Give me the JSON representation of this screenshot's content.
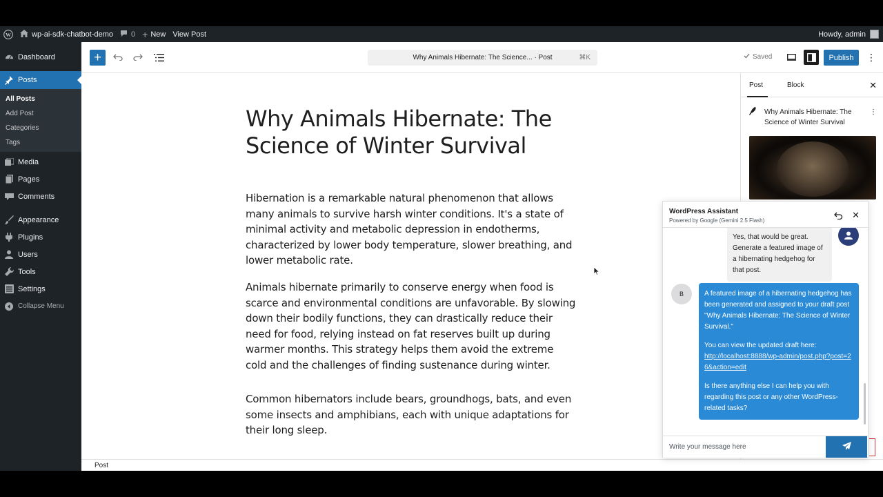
{
  "admin_bar": {
    "site_name": "wp-ai-sdk-chatbot-demo",
    "comments_count": "0",
    "new_label": "New",
    "view_post_label": "View Post",
    "howdy": "Howdy, admin"
  },
  "sidebar": {
    "items": [
      {
        "label": "Dashboard",
        "icon": "dashboard-icon"
      },
      {
        "label": "Posts",
        "icon": "pin-icon",
        "active": true
      },
      {
        "label": "Media",
        "icon": "media-icon"
      },
      {
        "label": "Pages",
        "icon": "page-icon"
      },
      {
        "label": "Comments",
        "icon": "comment-icon"
      },
      {
        "label": "Appearance",
        "icon": "brush-icon"
      },
      {
        "label": "Plugins",
        "icon": "plug-icon"
      },
      {
        "label": "Users",
        "icon": "users-icon"
      },
      {
        "label": "Tools",
        "icon": "wrench-icon"
      },
      {
        "label": "Settings",
        "icon": "settings-icon"
      },
      {
        "label": "Collapse Menu",
        "icon": "collapse-icon"
      }
    ],
    "submenu": [
      "All Posts",
      "Add Post",
      "Categories",
      "Tags"
    ]
  },
  "editor": {
    "doc_title_bar": "Why Animals Hibernate: The Science... · Post",
    "shortcut": "⌘K",
    "saved_label": "Saved",
    "publish_label": "Publish",
    "title": "Why Animals Hibernate: The Science of Winter Survival",
    "paragraphs": [
      "Hibernation is a remarkable natural phenomenon that allows many animals to survive harsh winter conditions. It's a state of minimal activity and metabolic depression in endotherms, characterized by lower body temperature, slower breathing, and lower metabolic rate.",
      "Animals hibernate primarily to conserve energy when food is scarce and environmental conditions are unfavorable. By slowing down their bodily functions, they can drastically reduce their need for food, relying instead on fat reserves built up during warmer months. This strategy helps them avoid the extreme cold and the challenges of finding sustenance during winter.",
      "Common hibernators include bears, groundhogs, bats, and even some insects and amphibians, each with unique adaptations for their long sleep."
    ],
    "status_label": "Post"
  },
  "settings_panel": {
    "tabs": [
      "Post",
      "Block"
    ],
    "post_title": "Why Animals Hibernate: The Science of Winter Survival"
  },
  "chat": {
    "title": "WordPress Assistant",
    "subtitle": "Powered by Google (Gemini 2.5 Flash)",
    "user_message": "Yes, that would be great. Generate a featured image of a hibernating hedgehog for that post.",
    "bot_avatar_letter": "B",
    "bot_message_1": "A featured image of a hibernating hedgehog has been generated and assigned to your draft post \"Why Animals Hibernate: The Science of Winter Survival.\"",
    "bot_message_2": "You can view the updated draft here:",
    "bot_link": "http://localhost:8888/wp-admin/post.php?post=26&action=edit",
    "bot_message_3": "Is there anything else I can help you with regarding this post or any other WordPress-related tasks?",
    "input_placeholder": "Write your message here"
  },
  "colors": {
    "admin_dark": "#1d2327",
    "accent_blue": "#2271b1",
    "bot_bubble": "#2a8ad5"
  }
}
